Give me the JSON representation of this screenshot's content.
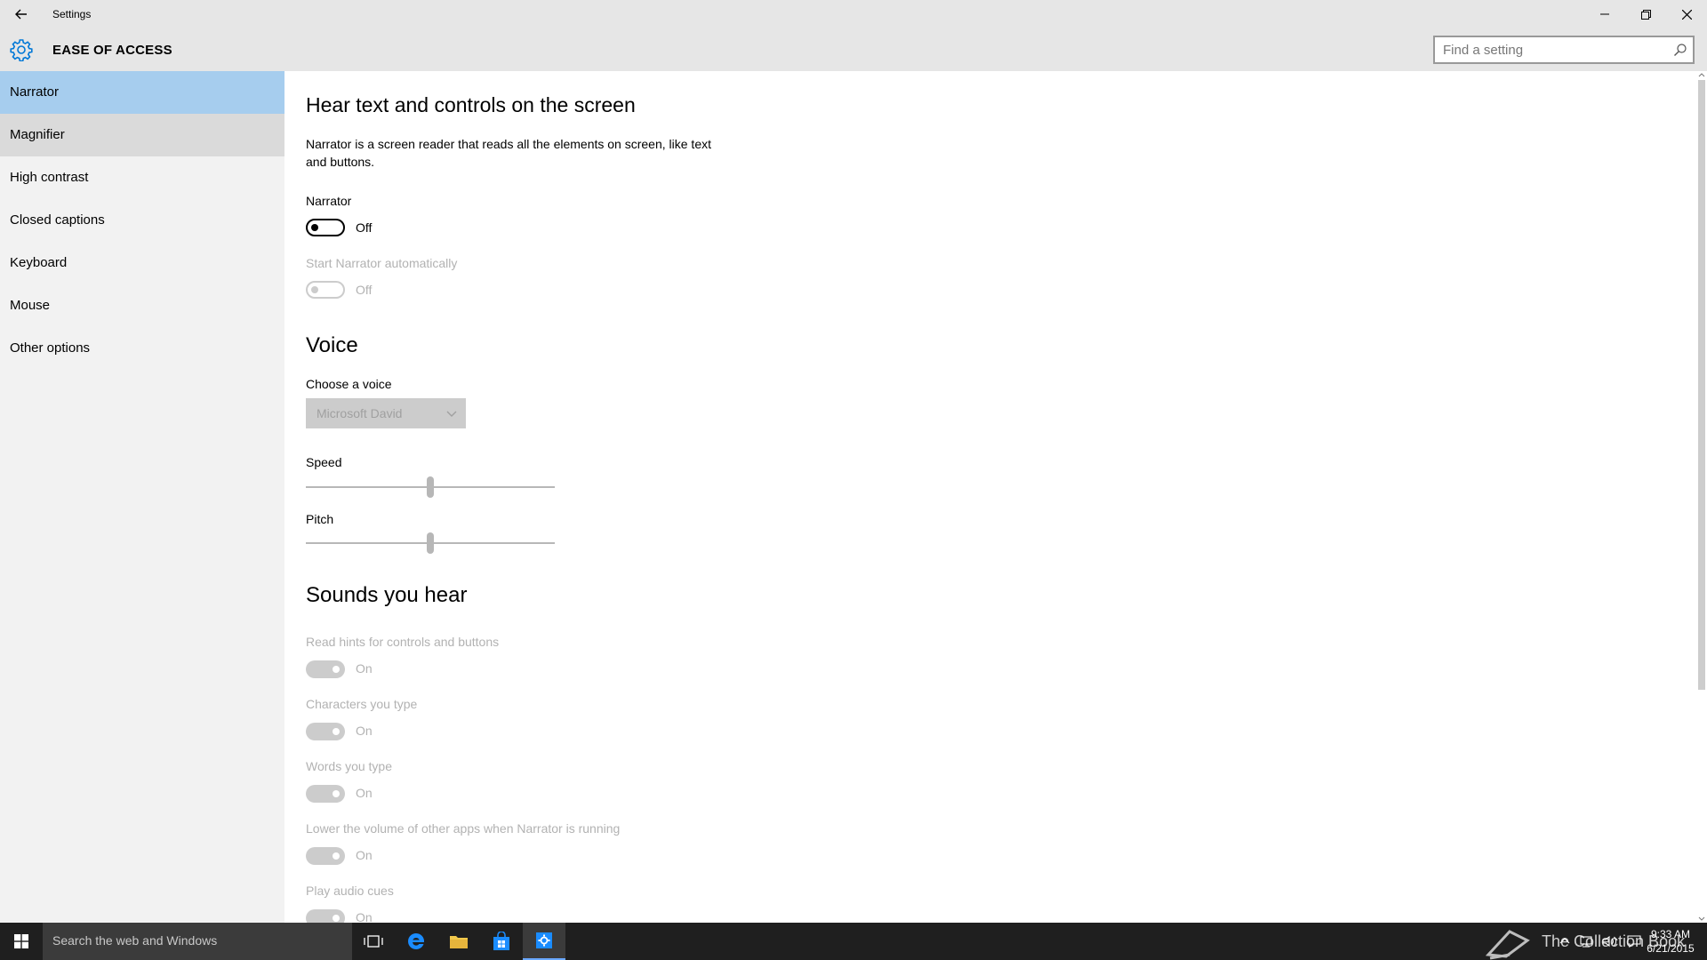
{
  "window": {
    "title": "Settings"
  },
  "header": {
    "section_title": "EASE OF ACCESS",
    "search_placeholder": "Find a setting"
  },
  "sidebar": {
    "items": [
      {
        "label": "Narrator",
        "state": "selected"
      },
      {
        "label": "Magnifier",
        "state": "hover"
      },
      {
        "label": "High contrast"
      },
      {
        "label": "Closed captions"
      },
      {
        "label": "Keyboard"
      },
      {
        "label": "Mouse"
      },
      {
        "label": "Other options"
      }
    ]
  },
  "content": {
    "heading": "Hear text and controls on the screen",
    "description": "Narrator is a screen reader that reads all the elements on screen, like text and buttons.",
    "narrator": {
      "label": "Narrator",
      "state": "Off"
    },
    "start_auto": {
      "label": "Start Narrator automatically",
      "state": "Off"
    },
    "voice": {
      "heading": "Voice",
      "choose_label": "Choose a voice",
      "selected_voice": "Microsoft David",
      "speed_label": "Speed",
      "speed_level": 0.5,
      "pitch_label": "Pitch",
      "pitch_level": 0.5
    },
    "sounds": {
      "heading": "Sounds you hear",
      "items": [
        {
          "label": "Read hints for controls and buttons",
          "state": "On"
        },
        {
          "label": "Characters you type",
          "state": "On"
        },
        {
          "label": "Words you type",
          "state": "On"
        },
        {
          "label": "Lower the volume of other apps when Narrator is running",
          "state": "On"
        },
        {
          "label": "Play audio cues",
          "state": "On"
        }
      ]
    }
  },
  "taskbar": {
    "search_text": "Search the web and Windows",
    "watermark": "The Collection Book",
    "time": "9:33 AM",
    "date": "6/21/2015"
  },
  "colors": {
    "accent": "#0078d7",
    "selected_nav": "#a6cdee",
    "chrome": "#e6e6e6",
    "sidebar": "#f2f2f2",
    "disabled": "#cccccc"
  }
}
